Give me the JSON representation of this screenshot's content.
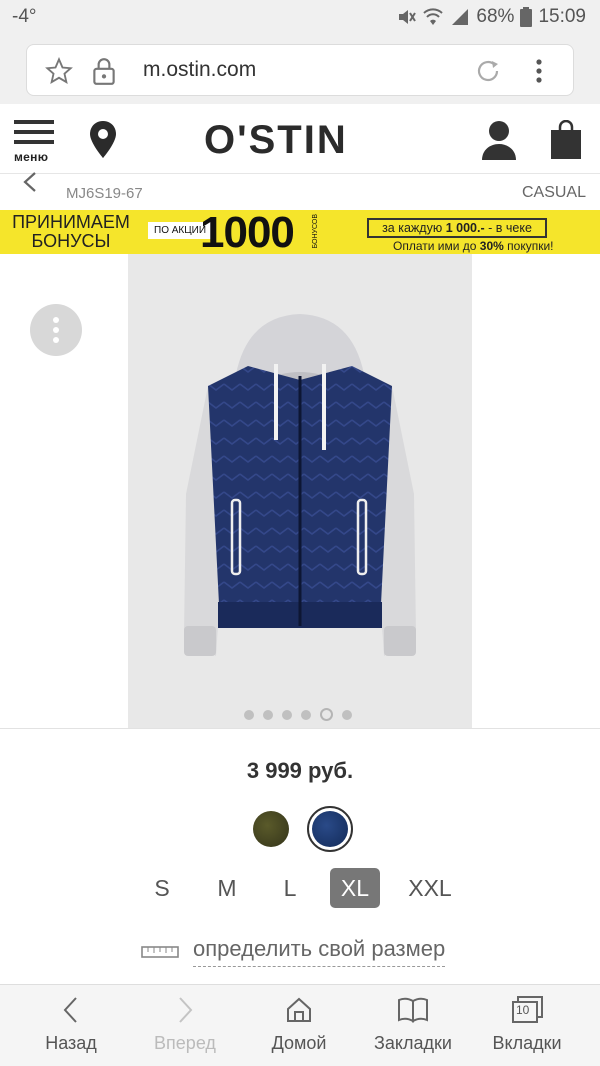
{
  "status_bar": {
    "temperature": "-4°",
    "battery": "68%",
    "time": "15:09"
  },
  "browser": {
    "url": "m.ostin.com"
  },
  "header": {
    "menu_label": "меню",
    "logo": "O'STIN"
  },
  "product": {
    "article": "MJ6S19-67",
    "category": "CASUAL",
    "price": "3 999 руб.",
    "colors": [
      {
        "name": "olive",
        "hex": "#3f3f20"
      },
      {
        "name": "navy",
        "hex": "#1a3266",
        "selected": true
      }
    ],
    "sizes": [
      "S",
      "M",
      "L",
      "XL",
      "XXL"
    ],
    "selected_size": "XL",
    "size_guide": "определить свой размер",
    "gallery": {
      "image_count": 6,
      "active_index": 4
    }
  },
  "promo": {
    "line1": "ПРИНИМАЕМ",
    "line2": "БОНУСЫ",
    "badge": "ПО АКЦИИ",
    "amount": "1000",
    "vertical": "БОНУСОВ",
    "box_prefix": "за каждую",
    "box_bold": "1 000.-",
    "box_suffix": "в чеке",
    "note_prefix": "Оплати ими до",
    "note_bold": "30%",
    "note_suffix": "покупки!"
  },
  "bottom_nav": {
    "back": "Назад",
    "forward": "Вперед",
    "home": "Домой",
    "bookmarks": "Закладки",
    "tabs": "Вкладки",
    "tab_count": "10"
  },
  "colors": {
    "promo_yellow": "#f5e52b",
    "logo_red": "#e41e26",
    "selected_size_bg": "#777777"
  }
}
